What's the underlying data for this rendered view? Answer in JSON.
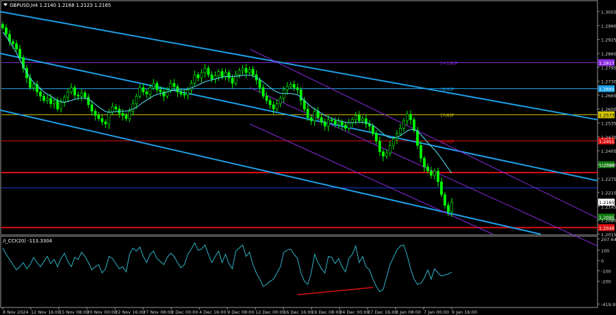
{
  "header": {
    "symbol_info": "GBPUSD,H4  1.2140 1.2168 1.2123 1.2165",
    "indicator_info": "/i_CCI(20) -113.3304"
  },
  "colors": {
    "background": "#000000",
    "frame": "#9a9a9a",
    "bull_candle": "#00ff00",
    "bear_candle": "#00ff00",
    "channel_blue": "#1e9fe8",
    "channel_purple": "#8a2be2",
    "moving_average": "#4cc9d9",
    "level_red": "#e01010",
    "level_blue": "#1a3fe0",
    "cci_line": "#2fb3c8",
    "divergence": "#e01010"
  },
  "chart_data": [
    {
      "type": "line",
      "name": "price",
      "ylim": [
        1.2015,
        1.3055
      ],
      "yticks": [
        "1.3055",
        "1.2990",
        "1.2925",
        "1.2860",
        "1.2795",
        "1.2730",
        "1.2665",
        "1.2600",
        "1.2535",
        "1.2470",
        "1.2405",
        "1.2340",
        "1.2275",
        "1.2210",
        "1.2145",
        "1.2080",
        "1.2015"
      ],
      "current_price": {
        "label": "1.2165",
        "value": 1.2165
      },
      "levels": [
        {
          "name": "level-1-2817",
          "label": "1.2817",
          "value": 1.2817,
          "color": "#8a2be2",
          "style": "solid",
          "tag": "[+1/8]P"
        },
        {
          "name": "level-1-2695",
          "label": "1.2695",
          "value": 1.2695,
          "color": "#1e9fe8",
          "style": "solid",
          "tag": "[8/8]P"
        },
        {
          "name": "level-1-2573",
          "label": "1.2573",
          "value": 1.2573,
          "color": "#d4c400",
          "style": "solid",
          "tag": "[7/8]P"
        },
        {
          "name": "level-1-2451",
          "label": "1.2451",
          "value": 1.2451,
          "color": "#e01010",
          "style": "solid",
          "tag": "[6/8]P"
        },
        {
          "name": "level-1-2340",
          "label": "1.2340",
          "value": 1.234,
          "color": "#0e7a0e",
          "style": "none",
          "tag": ""
        },
        {
          "name": "level-1-2303",
          "label": "",
          "value": 1.2303,
          "color": "#e01010",
          "style": "thick",
          "tag": ""
        },
        {
          "name": "level-1-2232",
          "label": "",
          "value": 1.2232,
          "color": "#1a3fe0",
          "style": "solid",
          "tag": ""
        },
        {
          "name": "level-1-2095",
          "label": "1.2095",
          "value": 1.2095,
          "color": "#0e7a0e",
          "style": "none",
          "tag": ""
        },
        {
          "name": "level-1-2046",
          "label": "1.2046",
          "value": 1.2046,
          "color": "#e01010",
          "style": "thick",
          "tag": ""
        }
      ],
      "series": [
        {
          "name": "close",
          "values": [
            1.298,
            1.295,
            1.2915,
            1.2905,
            1.288,
            1.284,
            1.279,
            1.2745,
            1.27,
            1.2715,
            1.268,
            1.266,
            1.264,
            1.265,
            1.2625,
            1.264,
            1.26,
            1.263,
            1.2655,
            1.268,
            1.27,
            1.2665,
            1.266,
            1.2675,
            1.2655,
            1.262,
            1.259,
            1.257,
            1.2555,
            1.254,
            1.253,
            1.2585,
            1.261,
            1.26,
            1.258,
            1.257,
            1.2555,
            1.259,
            1.2625,
            1.266,
            1.27,
            1.268,
            1.267,
            1.27,
            1.272,
            1.269,
            1.268,
            1.266,
            1.269,
            1.272,
            1.2705,
            1.268,
            1.267,
            1.2665,
            1.269,
            1.272,
            1.276,
            1.2745,
            1.277,
            1.279,
            1.276,
            1.274,
            1.2755,
            1.2775,
            1.275,
            1.277,
            1.2745,
            1.272,
            1.276,
            1.278,
            1.279,
            1.277,
            1.2785,
            1.276,
            1.2735,
            1.27,
            1.266,
            1.264,
            1.262,
            1.26,
            1.2625,
            1.265,
            1.269,
            1.2705,
            1.2715,
            1.27,
            1.269,
            1.264,
            1.26,
            1.256,
            1.2545,
            1.259,
            1.256,
            1.254,
            1.252,
            1.255,
            1.2545,
            1.253,
            1.254,
            1.2525,
            1.251,
            1.2535,
            1.255,
            1.257,
            1.2545,
            1.2555,
            1.253,
            1.252,
            1.2485,
            1.245,
            1.24,
            1.238,
            1.2395,
            1.243,
            1.246,
            1.2485,
            1.251,
            1.2545,
            1.2575,
            1.255,
            1.25,
            1.243,
            1.237,
            1.233,
            1.231,
            1.229,
            1.231,
            1.226,
            1.22,
            1.215,
            1.212,
            1.2165
          ]
        },
        {
          "name": "moving-average",
          "values": [
            1.296,
            1.294,
            1.2915,
            1.289,
            1.2862,
            1.283,
            1.28,
            1.277,
            1.2745,
            1.2725,
            1.271,
            1.2695,
            1.268,
            1.267,
            1.266,
            1.265,
            1.264,
            1.2635,
            1.2632,
            1.2635,
            1.264,
            1.2645,
            1.265,
            1.2652,
            1.265,
            1.2645,
            1.2635,
            1.2622,
            1.261,
            1.2598,
            1.2588,
            1.2585,
            1.2586,
            1.2588,
            1.259,
            1.259,
            1.259,
            1.2594,
            1.26,
            1.2608,
            1.262,
            1.2632,
            1.2642,
            1.2652,
            1.2662,
            1.2668,
            1.2672,
            1.2675,
            1.268,
            1.2685,
            1.2688,
            1.269,
            1.269,
            1.269,
            1.2692,
            1.2698,
            1.2705,
            1.2712,
            1.272,
            1.2728,
            1.2732,
            1.2736,
            1.274,
            1.2745,
            1.2748,
            1.2752,
            1.2753,
            1.2752,
            1.2753,
            1.2755,
            1.2757,
            1.2758,
            1.2758,
            1.2755,
            1.2748,
            1.2738,
            1.2726,
            1.2714,
            1.27,
            1.2688,
            1.268,
            1.2674,
            1.2672,
            1.2672,
            1.2672,
            1.267,
            1.2666,
            1.2655,
            1.264,
            1.2625,
            1.261,
            1.26,
            1.259,
            1.258,
            1.257,
            1.2563,
            1.2556,
            1.255,
            1.2546,
            1.2542,
            1.2538,
            1.2536,
            1.2536,
            1.2538,
            1.2538,
            1.2538,
            1.2536,
            1.2532,
            1.2524,
            1.2512,
            1.2498,
            1.2484,
            1.2472,
            1.2466,
            1.2465,
            1.2468,
            1.2475,
            1.2486,
            1.2498,
            1.2504,
            1.2503,
            1.2495,
            1.248,
            1.2462,
            1.2443,
            1.2425,
            1.241,
            1.239,
            1.2368,
            1.2345,
            1.2322,
            1.23
          ]
        }
      ]
    },
    {
      "type": "line",
      "name": "cci",
      "ylim": [
        -419.9544,
        207.6441
      ],
      "yticks": [
        "207.6441",
        "100",
        "0",
        "-100",
        "-200",
        "-419.9544"
      ],
      "series": [
        {
          "name": "cci",
          "values": [
            120,
            60,
            10,
            -40,
            -90,
            -60,
            -20,
            -80,
            -40,
            30,
            -20,
            -60,
            -10,
            40,
            -30,
            10,
            -60,
            20,
            70,
            -10,
            -60,
            30,
            10,
            80,
            40,
            -20,
            -90,
            -60,
            -40,
            -120,
            -80,
            40,
            20,
            -30,
            -80,
            -60,
            -110,
            60,
            120,
            90,
            130,
            40,
            -20,
            60,
            90,
            20,
            -10,
            -40,
            30,
            70,
            40,
            -20,
            -70,
            -40,
            60,
            110,
            170,
            100,
            110,
            150,
            60,
            -20,
            40,
            90,
            -20,
            60,
            -30,
            -80,
            90,
            120,
            150,
            40,
            80,
            -40,
            -120,
            -180,
            -250,
            -230,
            -200,
            -180,
            -120,
            -60,
            80,
            100,
            110,
            60,
            20,
            -120,
            -200,
            -230,
            -120,
            60,
            -20,
            -80,
            -120,
            40,
            30,
            -30,
            20,
            -60,
            -110,
            20,
            60,
            140,
            -20,
            40,
            -60,
            -90,
            -180,
            -250,
            -300,
            -280,
            -160,
            -40,
            30,
            100,
            140,
            150,
            50,
            -80,
            -180,
            -230,
            -220,
            -170,
            -90,
            -180,
            -80,
            -120,
            -150,
            -140,
            -130,
            -113
          ]
        }
      ],
      "divergence": {
        "from_index": 86,
        "from_value": -330,
        "to_index": 108,
        "to_value": -260
      }
    }
  ],
  "x_axis": {
    "labels": [
      "8 Nov 2024",
      "12 Nov 16:00",
      "15 Nov 08:00",
      "20 Nov 00:00",
      "22 Nov 16:00",
      "27 Nov 08:00",
      "2 Dec 00:00",
      "4 Dec 16:00",
      "9 Dec 08:00",
      "12 Dec 00:00",
      "16 Dec 16:00",
      "19 Dec 08:00",
      "24 Dec 00:00",
      "27 Dec 16:00",
      "2 Jan 08:00",
      "7 Jan 00:00",
      "9 Jan 16:00"
    ]
  }
}
